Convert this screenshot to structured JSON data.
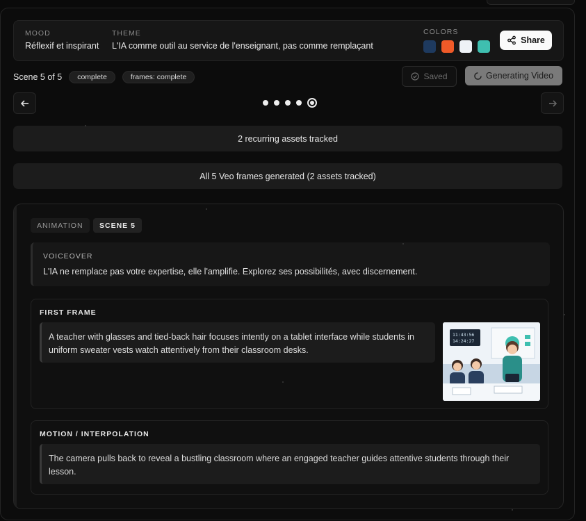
{
  "header": {
    "mood_label": "MOOD",
    "mood_value": "Réflexif et inspirant",
    "theme_label": "THEME",
    "theme_value": "L'IA comme outil au service de l'enseignant, pas comme remplaçant",
    "colors_label": "COLORS",
    "colors": [
      "#1e3a5f",
      "#f05a28",
      "#eef2f6",
      "#3fbfb0"
    ],
    "share_label": "Share"
  },
  "scene_bar": {
    "scene_text": "Scene 5 of 5",
    "status_badge": "complete",
    "frames_badge": "frames: complete",
    "saved_label": "Saved",
    "generate_label": "Generating Video"
  },
  "pagination": {
    "total": 5,
    "current": 5
  },
  "recurring_assets": "2 recurring assets tracked",
  "frames_status": "All 5 Veo frames generated (2 assets tracked)",
  "card": {
    "tag_type": "ANIMATION",
    "tag_scene": "SCENE 5",
    "voiceover_label": "VOICEOVER",
    "voiceover_text": "L'IA ne remplace pas votre expertise, elle l'amplifie. Explorez ses possibilités, avec discernement.",
    "first_frame_label": "FIRST FRAME",
    "first_frame_text": "A teacher with glasses and tied-back hair focuses intently on a tablet interface while students in uniform sweater vests watch attentively from their classroom desks.",
    "thumb_screen_line1": "11:43:56",
    "thumb_screen_line2": "14:24:27",
    "motion_label": "MOTION / INTERPOLATION",
    "motion_text": "The camera pulls back to reveal a bustling classroom where an engaged teacher guides attentive students through their lesson."
  }
}
